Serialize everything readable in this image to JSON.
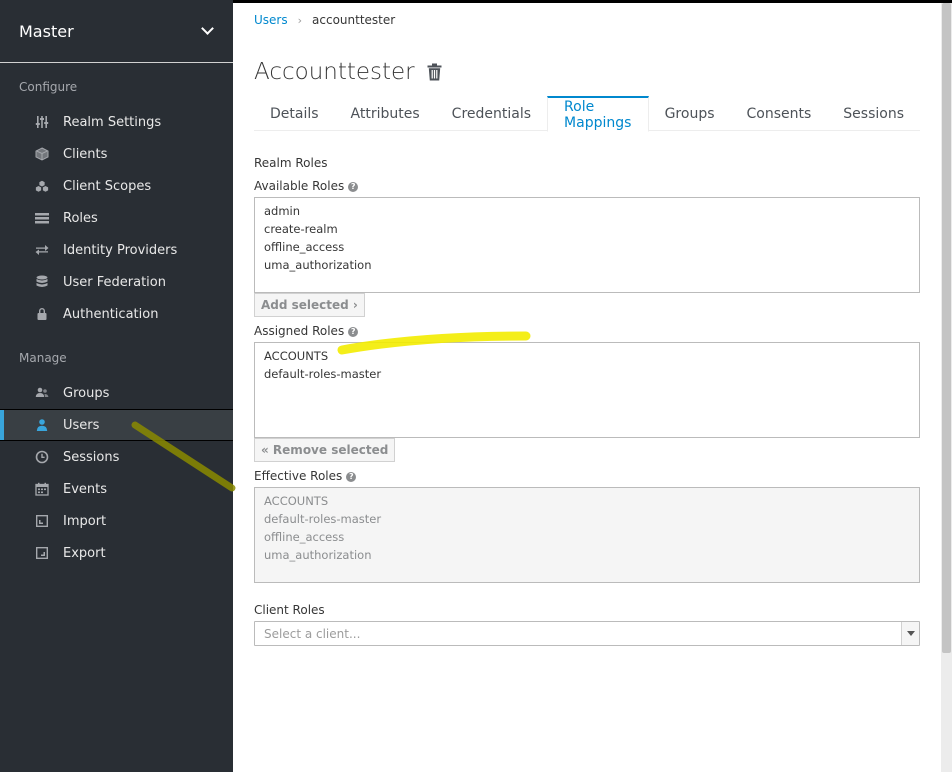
{
  "sidebar": {
    "realm": "Master",
    "configure_label": "Configure",
    "manage_label": "Manage",
    "configure_items": [
      {
        "label": "Realm Settings",
        "icon": "sliders-icon"
      },
      {
        "label": "Clients",
        "icon": "cube-icon"
      },
      {
        "label": "Client Scopes",
        "icon": "cubes-icon"
      },
      {
        "label": "Roles",
        "icon": "list-icon"
      },
      {
        "label": "Identity Providers",
        "icon": "exchange-icon"
      },
      {
        "label": "User Federation",
        "icon": "database-icon"
      },
      {
        "label": "Authentication",
        "icon": "lock-icon"
      }
    ],
    "manage_items": [
      {
        "label": "Groups",
        "icon": "users-icon"
      },
      {
        "label": "Users",
        "icon": "user-icon"
      },
      {
        "label": "Sessions",
        "icon": "clock-icon"
      },
      {
        "label": "Events",
        "icon": "calendar-icon"
      },
      {
        "label": "Import",
        "icon": "import-icon"
      },
      {
        "label": "Export",
        "icon": "export-icon"
      }
    ]
  },
  "breadcrumb": {
    "parent": "Users",
    "current": "accounttester"
  },
  "page": {
    "title": "Accounttester"
  },
  "tabs": [
    "Details",
    "Attributes",
    "Credentials",
    "Role Mappings",
    "Groups",
    "Consents",
    "Sessions"
  ],
  "active_tab": "Role Mappings",
  "realm_roles": {
    "heading": "Realm Roles",
    "available_label": "Available Roles",
    "available": [
      "admin",
      "create-realm",
      "offline_access",
      "uma_authorization"
    ],
    "add_button": "Add selected ›",
    "assigned_label": "Assigned Roles",
    "assigned": [
      "ACCOUNTS",
      "default-roles-master"
    ],
    "remove_button": "« Remove selected",
    "effective_label": "Effective Roles",
    "effective": [
      "ACCOUNTS",
      "default-roles-master",
      "offline_access",
      "uma_authorization"
    ]
  },
  "client_roles": {
    "heading": "Client Roles",
    "placeholder": "Select a client..."
  },
  "colors": {
    "sidebar_bg": "#292e34",
    "accent": "#0088ce",
    "active_marker": "#39a5dc",
    "highlight_yellow": "#f3ec00",
    "highlight_olive": "#8a8a00"
  }
}
